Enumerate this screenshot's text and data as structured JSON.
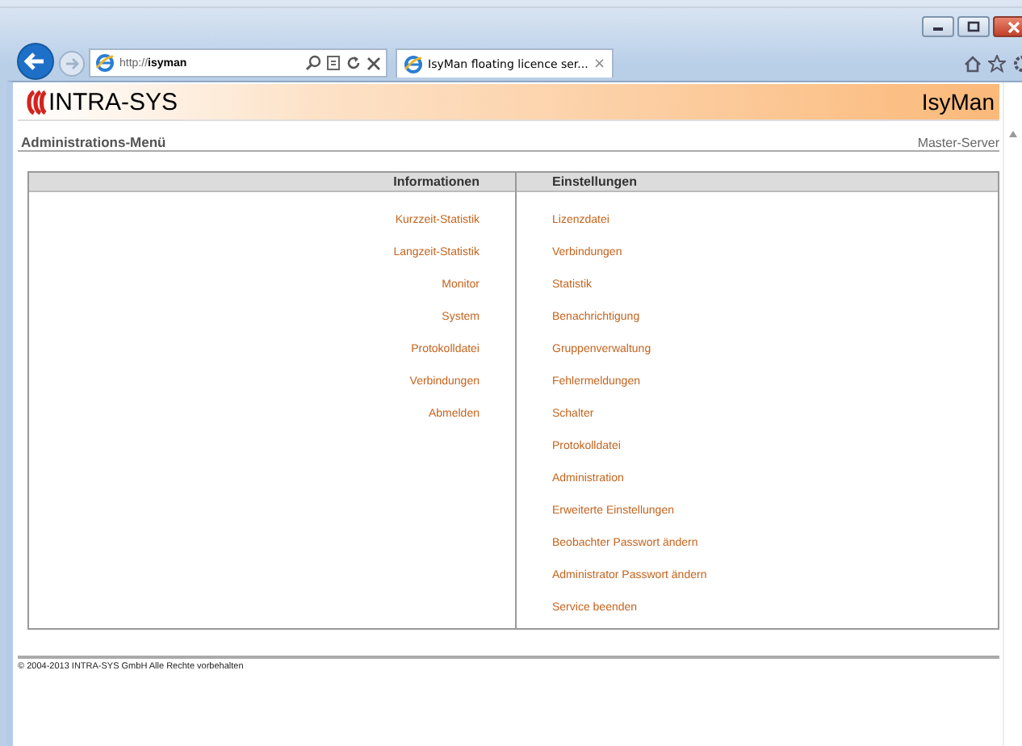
{
  "browser": {
    "address": "http://**isyman**",
    "tab_title": "IsyMan floating licence ser...",
    "tab_close": "×"
  },
  "header": {
    "logo": "INTRA-SYS",
    "product": "IsyMan"
  },
  "subheader": {
    "title": "Administrations-Menü",
    "server": "Master-Server"
  },
  "menu": {
    "columns": [
      {
        "heading": "Informationen",
        "items": [
          "Kurzzeit-Statistik",
          "Langzeit-Statistik",
          "Monitor",
          "System",
          "Protokolldatei",
          "Verbindungen",
          "Abmelden"
        ]
      },
      {
        "heading": "Einstellungen",
        "items": [
          "Lizenzdatei",
          "Verbindungen",
          "Statistik",
          "Benachrichtigung",
          "Gruppenverwaltung",
          "Fehlermeldungen",
          "Schalter",
          "Protokolldatei",
          "Administration",
          "Erweiterte Einstellungen",
          "Beobachter Passwort ändern",
          "Administrator Passwort ändern",
          "Service beenden"
        ]
      }
    ]
  },
  "footer": "© 2004-2013 INTRA-SYS GmbH Alle Rechte vorbehalten"
}
